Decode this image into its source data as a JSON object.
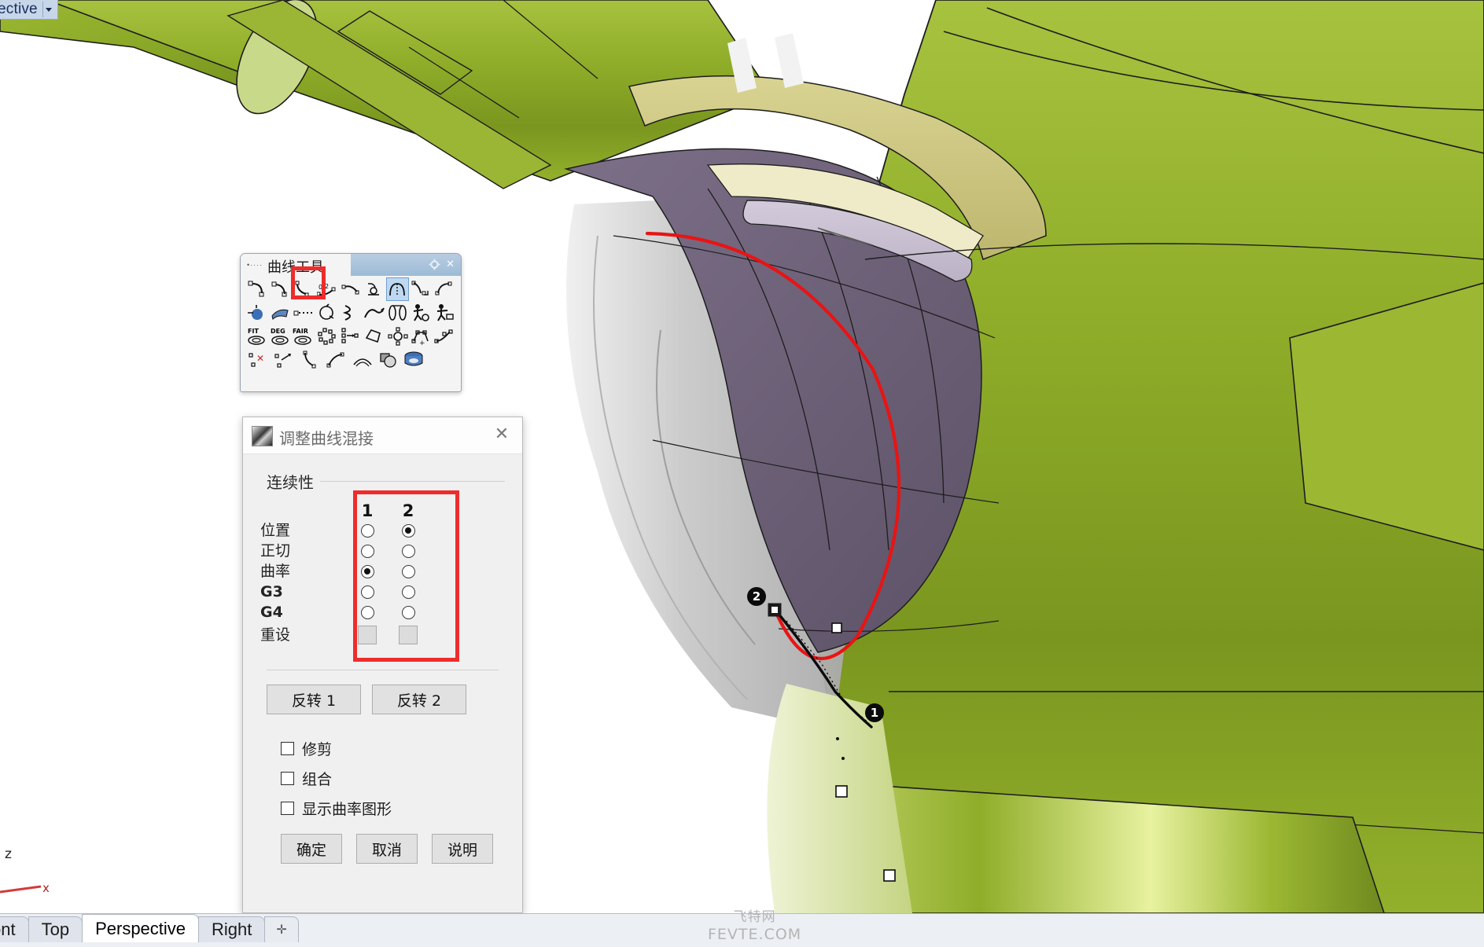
{
  "viewport": {
    "title_label": "rspective",
    "title_caret_icon": "chevron-down-icon",
    "axis_z_label": "z",
    "axis_x_label": "x"
  },
  "curve_toolbar": {
    "title": "曲线工具",
    "grip_icon": "drag-grip-icon",
    "gear_icon": "gear-icon",
    "close_icon": "close-icon",
    "highlight_color": "#ee2c2c",
    "selected_icon_name": "blend-curve-tool-icon",
    "rows": [
      [
        "arc-blend-icon",
        "curve-blend-icon",
        "point-curve-icon",
        "adjust-blend-icon",
        "handle-curve-icon",
        "fillet-corners-icon",
        "blend-surface-curve-icon",
        "tween-curve-icon",
        "offset-curve-icon"
      ],
      [
        "project-curve-icon",
        "pull-curve-icon",
        "extend-curve-icon",
        "rotate-curve-icon",
        "twist-curve-icon",
        "flow-curve-icon",
        "revolve-curve-icon",
        "sketch-curve-icon",
        "sketch-camera-icon"
      ],
      [
        "fit-curve-icon",
        "change-degree-icon",
        "fair-curve-icon",
        "rebuild-points-icon",
        "insert-knot-icon",
        "simplify-curve-icon",
        "control-points-icon",
        "polygon-edit-icon",
        "add-point-icon"
      ],
      [
        "remove-point-icon",
        "move-point-icon",
        "curve-handle-icon",
        "curvature-graph-icon",
        "arc-radius-icon",
        "boolean-curve-icon",
        "extrude-curve-icon"
      ]
    ]
  },
  "dialog": {
    "icon_name": "blend-preview-icon",
    "title": "调整曲线混接",
    "close_icon": "close-icon",
    "group_label": "连续性",
    "highlight_color": "#ee2c2c",
    "columns": [
      "1",
      "2"
    ],
    "continuity_rows": [
      {
        "label": "位置",
        "col1_selected": false,
        "col2_selected": true
      },
      {
        "label": "正切",
        "col1_selected": false,
        "col2_selected": false
      },
      {
        "label": "曲率",
        "col1_selected": true,
        "col2_selected": false
      },
      {
        "label": "G3",
        "col1_selected": false,
        "col2_selected": false
      },
      {
        "label": "G4",
        "col1_selected": false,
        "col2_selected": false
      }
    ],
    "reset_row_label": "重设",
    "flip_buttons": [
      {
        "label": "反转 1"
      },
      {
        "label": "反转 2"
      }
    ],
    "checkboxes": [
      {
        "label": "修剪",
        "checked": false
      },
      {
        "label": "组合",
        "checked": false
      },
      {
        "label": "显示曲率图形",
        "checked": false
      }
    ],
    "action_buttons": [
      {
        "label": "确定"
      },
      {
        "label": "取消"
      },
      {
        "label": "说明"
      }
    ]
  },
  "scene": {
    "markers": [
      {
        "label": "2"
      },
      {
        "label": "1"
      }
    ],
    "blend_curve_color": "#e81414",
    "body_green": "#8fad29",
    "body_purple": "#6f6378",
    "body_khaki": "#cdc77f"
  },
  "tabbar": {
    "tabs": [
      {
        "label": "ont",
        "active": false
      },
      {
        "label": "Top",
        "active": false
      },
      {
        "label": "Perspective",
        "active": true
      },
      {
        "label": "Right",
        "active": false
      },
      {
        "label": "✛",
        "active": false
      }
    ]
  },
  "watermark": {
    "cn": "飞特网",
    "en": "FEVTE.COM"
  }
}
